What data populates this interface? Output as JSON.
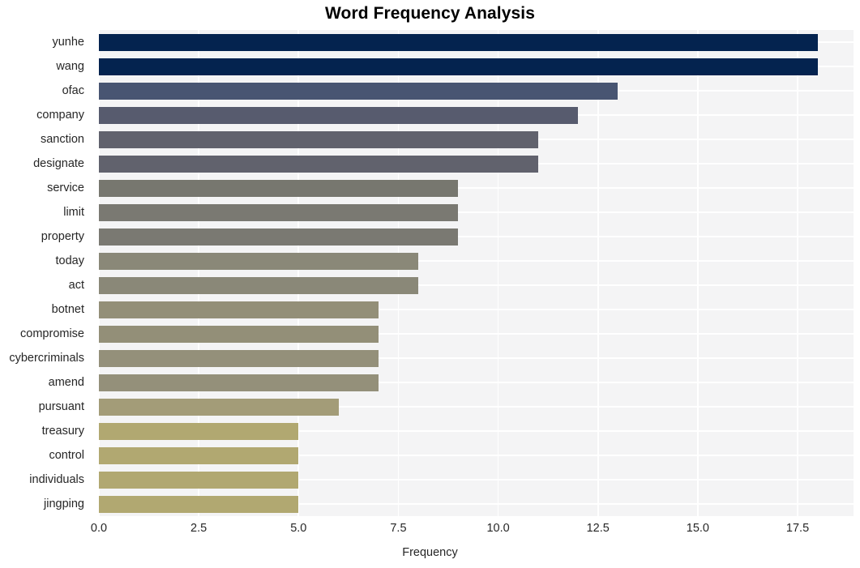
{
  "figure": {
    "title": "Word Frequency Analysis",
    "background_color": "#ffffff",
    "plot_background_color": "#f4f4f5",
    "grid_color": "#ffffff"
  },
  "chart_data": {
    "type": "bar",
    "orientation": "horizontal",
    "title": "Word Frequency Analysis",
    "xlabel": "Frequency",
    "ylabel": "",
    "categories": [
      "yunhe",
      "wang",
      "ofac",
      "company",
      "sanction",
      "designate",
      "service",
      "limit",
      "property",
      "today",
      "act",
      "botnet",
      "compromise",
      "cybercriminals",
      "amend",
      "pursuant",
      "treasury",
      "control",
      "individuals",
      "jingping"
    ],
    "values": [
      18,
      18,
      13,
      12,
      11,
      11,
      9,
      9,
      9,
      8,
      8,
      7,
      7,
      7,
      7,
      6,
      5,
      5,
      5,
      5
    ],
    "bar_colors": [
      "#04234f",
      "#04234f",
      "#485572",
      "#575b6e",
      "#61626d",
      "#61626d",
      "#77776f",
      "#7a7972",
      "#7a7972",
      "#8a8878",
      "#8a8878",
      "#938f78",
      "#938f78",
      "#94907a",
      "#94907a",
      "#a39c78",
      "#b1a871",
      "#b1a871",
      "#b1a871",
      "#b1a871"
    ],
    "xlim": [
      0,
      18.9
    ],
    "xticks": [
      0.0,
      2.5,
      5.0,
      7.5,
      10.0,
      12.5,
      15.0,
      17.5
    ],
    "xticklabels": [
      "0.0",
      "2.5",
      "5.0",
      "7.5",
      "10.0",
      "12.5",
      "15.0",
      "17.5"
    ],
    "grid": true,
    "legend": null
  }
}
